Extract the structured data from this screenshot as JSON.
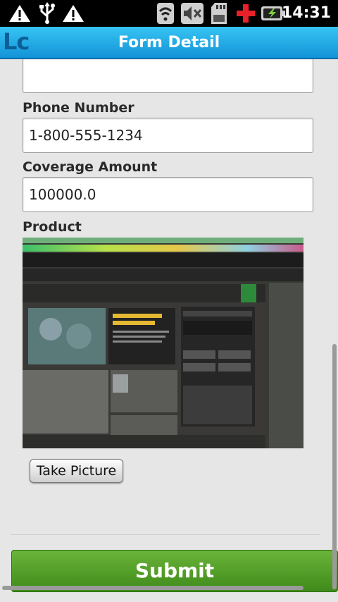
{
  "status_bar": {
    "time": "14:31",
    "icons": [
      "warning-icon",
      "usb-icon",
      "warning-icon",
      "wifi-icon",
      "mute-icon",
      "sd-card-icon",
      "red-cross-icon",
      "battery-charging-icon"
    ]
  },
  "app": {
    "logo": "Lc",
    "title": "Form Detail",
    "accent_color": "#1ea6e6"
  },
  "form": {
    "fields": [
      {
        "label": "Phone Number",
        "value": "1-800-555-1234"
      },
      {
        "label": "Coverage Amount",
        "value": "100000.0"
      }
    ],
    "product_label": "Product",
    "take_picture_label": "Take Picture",
    "submit_label": "Submit",
    "submit_color": "#4e9a26"
  }
}
